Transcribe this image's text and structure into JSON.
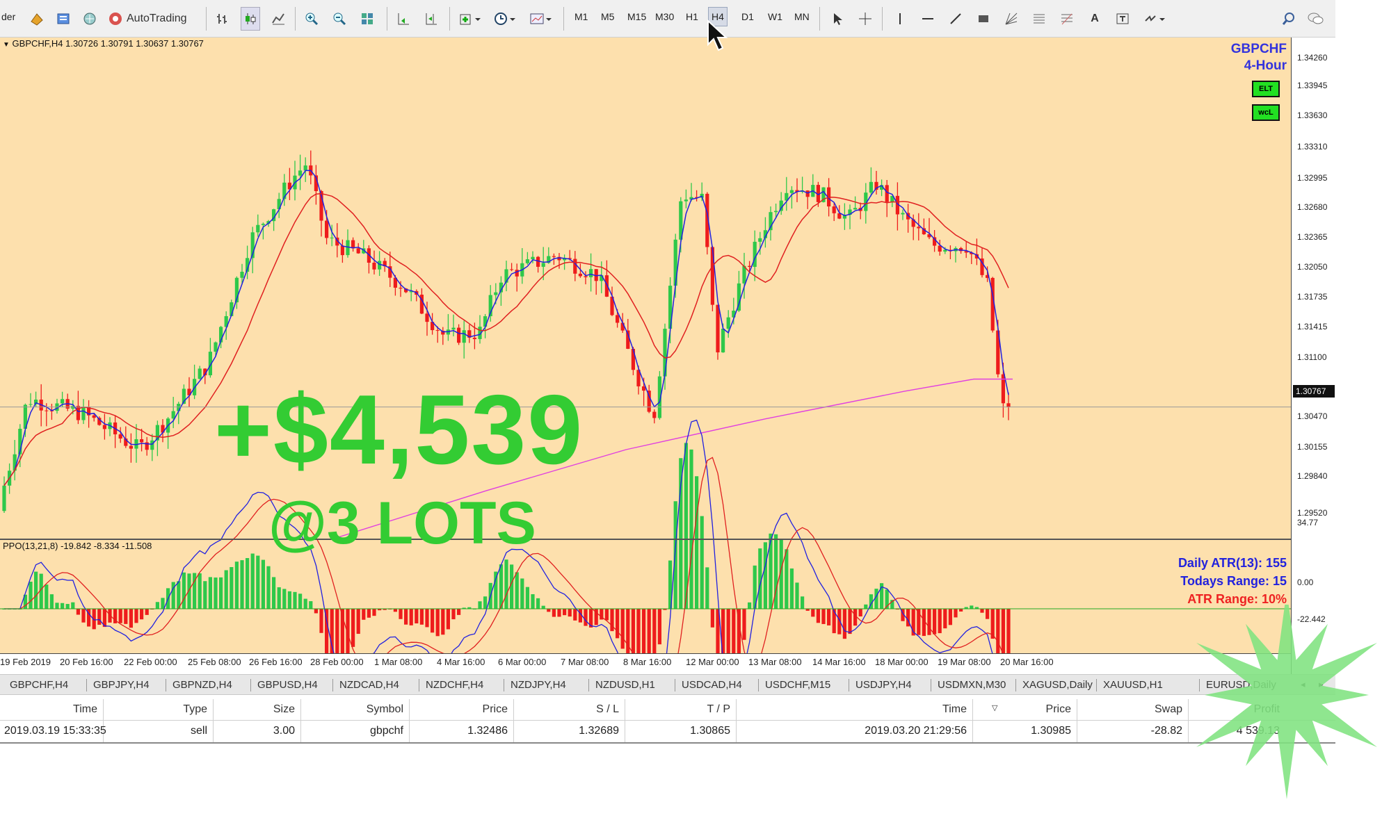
{
  "toolbar": {
    "trader_label": "der",
    "autotrading_label": "AutoTrading",
    "timeframes": [
      "M1",
      "M5",
      "M15",
      "M30",
      "H1",
      "H4",
      "D1",
      "W1",
      "MN"
    ],
    "active_timeframe": "H4"
  },
  "chart": {
    "header": "GBPCHF,H4  1.30726 1.30791 1.30637 1.30767",
    "symbol_label": "GBPCHF",
    "period_label": "4-Hour",
    "badge1": "ELT",
    "badge2": "wcL",
    "current_price": "1.30767",
    "price_ticks": [
      "1.34260",
      "1.33945",
      "1.33630",
      "1.33310",
      "1.32995",
      "1.32680",
      "1.32365",
      "1.32050",
      "1.31735",
      "1.31415",
      "1.31100",
      "1.30470",
      "1.30155",
      "1.29840",
      "1.29520"
    ],
    "colors": {
      "background": "#fde0ad",
      "bull": "#2ec84a",
      "bear": "#ee1c1c",
      "fast_ma": "#2020e0",
      "slow_ma": "#e02020",
      "long_ma": "#e040e0"
    }
  },
  "indicator": {
    "header": "PPO(13,21,8) -19.842 -8.334 -11.508",
    "scale_top": "34.77",
    "scale_zero": "0.00",
    "scale_bottom": "-22.442",
    "atr_label": "Daily ATR(13): 155",
    "range_label": "Todays Range: 15",
    "atr_range_label": "ATR Range: 10%"
  },
  "date_axis": [
    "19 Feb 2019",
    "20 Feb 16:00",
    "22 Feb 00:00",
    "25 Feb 08:00",
    "26 Feb 16:00",
    "28 Feb 00:00",
    "1 Mar 08:00",
    "4 Mar 16:00",
    "6 Mar 00:00",
    "7 Mar 08:00",
    "8 Mar 16:00",
    "12 Mar 00:00",
    "13 Mar 08:00",
    "14 Mar 16:00",
    "18 Mar 00:00",
    "19 Mar 08:00",
    "20 Mar 16:00"
  ],
  "symbol_tabs": [
    "GBPCHF,H4",
    "GBPJPY,H4",
    "GBPNZD,H4",
    "GBPUSD,H4",
    "NZDCAD,H4",
    "NZDCHF,H4",
    "NZDJPY,H4",
    "NZDUSD,H1",
    "USDCAD,H4",
    "USDCHF,M15",
    "USDJPY,H4",
    "USDMXN,M30",
    "XAGUSD,Daily",
    "XAUUSD,H1",
    "EURUSD,Daily"
  ],
  "trade": {
    "headers": [
      "Time",
      "Type",
      "Size",
      "Symbol",
      "Price",
      "S / L",
      "T / P",
      "Time",
      "Price",
      "Swap",
      "Profit"
    ],
    "row": [
      "2019.03.19 15:33:35",
      "sell",
      "3.00",
      "gbpchf",
      "1.32486",
      "1.32689",
      "1.30865",
      "2019.03.20 21:29:56",
      "1.30985",
      "-28.82",
      "4 539.13"
    ]
  },
  "overlay": {
    "profit_text": "+$4,539",
    "lots_text": "@3 LOTS",
    "color": "#33cc33"
  }
}
